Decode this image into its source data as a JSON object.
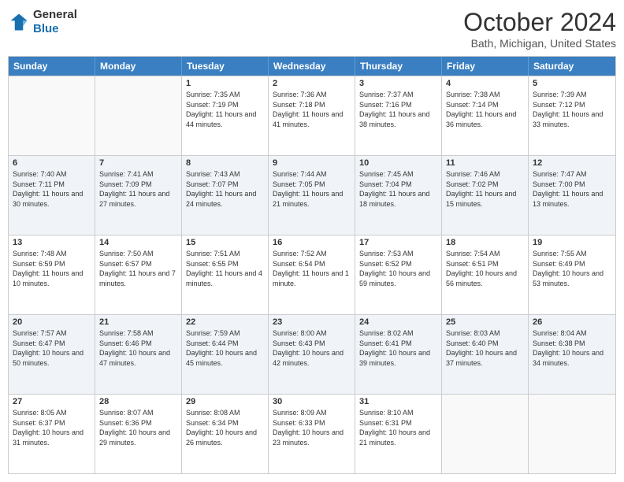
{
  "header": {
    "logo_general": "General",
    "logo_blue": "Blue",
    "title": "October 2024",
    "subtitle": "Bath, Michigan, United States"
  },
  "days": [
    "Sunday",
    "Monday",
    "Tuesday",
    "Wednesday",
    "Thursday",
    "Friday",
    "Saturday"
  ],
  "rows": [
    [
      {
        "num": "",
        "sunrise": "",
        "sunset": "",
        "daylight": "",
        "empty": true
      },
      {
        "num": "",
        "sunrise": "",
        "sunset": "",
        "daylight": "",
        "empty": true
      },
      {
        "num": "1",
        "sunrise": "Sunrise: 7:35 AM",
        "sunset": "Sunset: 7:19 PM",
        "daylight": "Daylight: 11 hours and 44 minutes."
      },
      {
        "num": "2",
        "sunrise": "Sunrise: 7:36 AM",
        "sunset": "Sunset: 7:18 PM",
        "daylight": "Daylight: 11 hours and 41 minutes."
      },
      {
        "num": "3",
        "sunrise": "Sunrise: 7:37 AM",
        "sunset": "Sunset: 7:16 PM",
        "daylight": "Daylight: 11 hours and 38 minutes."
      },
      {
        "num": "4",
        "sunrise": "Sunrise: 7:38 AM",
        "sunset": "Sunset: 7:14 PM",
        "daylight": "Daylight: 11 hours and 36 minutes."
      },
      {
        "num": "5",
        "sunrise": "Sunrise: 7:39 AM",
        "sunset": "Sunset: 7:12 PM",
        "daylight": "Daylight: 11 hours and 33 minutes."
      }
    ],
    [
      {
        "num": "6",
        "sunrise": "Sunrise: 7:40 AM",
        "sunset": "Sunset: 7:11 PM",
        "daylight": "Daylight: 11 hours and 30 minutes."
      },
      {
        "num": "7",
        "sunrise": "Sunrise: 7:41 AM",
        "sunset": "Sunset: 7:09 PM",
        "daylight": "Daylight: 11 hours and 27 minutes."
      },
      {
        "num": "8",
        "sunrise": "Sunrise: 7:43 AM",
        "sunset": "Sunset: 7:07 PM",
        "daylight": "Daylight: 11 hours and 24 minutes."
      },
      {
        "num": "9",
        "sunrise": "Sunrise: 7:44 AM",
        "sunset": "Sunset: 7:05 PM",
        "daylight": "Daylight: 11 hours and 21 minutes."
      },
      {
        "num": "10",
        "sunrise": "Sunrise: 7:45 AM",
        "sunset": "Sunset: 7:04 PM",
        "daylight": "Daylight: 11 hours and 18 minutes."
      },
      {
        "num": "11",
        "sunrise": "Sunrise: 7:46 AM",
        "sunset": "Sunset: 7:02 PM",
        "daylight": "Daylight: 11 hours and 15 minutes."
      },
      {
        "num": "12",
        "sunrise": "Sunrise: 7:47 AM",
        "sunset": "Sunset: 7:00 PM",
        "daylight": "Daylight: 11 hours and 13 minutes."
      }
    ],
    [
      {
        "num": "13",
        "sunrise": "Sunrise: 7:48 AM",
        "sunset": "Sunset: 6:59 PM",
        "daylight": "Daylight: 11 hours and 10 minutes."
      },
      {
        "num": "14",
        "sunrise": "Sunrise: 7:50 AM",
        "sunset": "Sunset: 6:57 PM",
        "daylight": "Daylight: 11 hours and 7 minutes."
      },
      {
        "num": "15",
        "sunrise": "Sunrise: 7:51 AM",
        "sunset": "Sunset: 6:55 PM",
        "daylight": "Daylight: 11 hours and 4 minutes."
      },
      {
        "num": "16",
        "sunrise": "Sunrise: 7:52 AM",
        "sunset": "Sunset: 6:54 PM",
        "daylight": "Daylight: 11 hours and 1 minute."
      },
      {
        "num": "17",
        "sunrise": "Sunrise: 7:53 AM",
        "sunset": "Sunset: 6:52 PM",
        "daylight": "Daylight: 10 hours and 59 minutes."
      },
      {
        "num": "18",
        "sunrise": "Sunrise: 7:54 AM",
        "sunset": "Sunset: 6:51 PM",
        "daylight": "Daylight: 10 hours and 56 minutes."
      },
      {
        "num": "19",
        "sunrise": "Sunrise: 7:55 AM",
        "sunset": "Sunset: 6:49 PM",
        "daylight": "Daylight: 10 hours and 53 minutes."
      }
    ],
    [
      {
        "num": "20",
        "sunrise": "Sunrise: 7:57 AM",
        "sunset": "Sunset: 6:47 PM",
        "daylight": "Daylight: 10 hours and 50 minutes."
      },
      {
        "num": "21",
        "sunrise": "Sunrise: 7:58 AM",
        "sunset": "Sunset: 6:46 PM",
        "daylight": "Daylight: 10 hours and 47 minutes."
      },
      {
        "num": "22",
        "sunrise": "Sunrise: 7:59 AM",
        "sunset": "Sunset: 6:44 PM",
        "daylight": "Daylight: 10 hours and 45 minutes."
      },
      {
        "num": "23",
        "sunrise": "Sunrise: 8:00 AM",
        "sunset": "Sunset: 6:43 PM",
        "daylight": "Daylight: 10 hours and 42 minutes."
      },
      {
        "num": "24",
        "sunrise": "Sunrise: 8:02 AM",
        "sunset": "Sunset: 6:41 PM",
        "daylight": "Daylight: 10 hours and 39 minutes."
      },
      {
        "num": "25",
        "sunrise": "Sunrise: 8:03 AM",
        "sunset": "Sunset: 6:40 PM",
        "daylight": "Daylight: 10 hours and 37 minutes."
      },
      {
        "num": "26",
        "sunrise": "Sunrise: 8:04 AM",
        "sunset": "Sunset: 6:38 PM",
        "daylight": "Daylight: 10 hours and 34 minutes."
      }
    ],
    [
      {
        "num": "27",
        "sunrise": "Sunrise: 8:05 AM",
        "sunset": "Sunset: 6:37 PM",
        "daylight": "Daylight: 10 hours and 31 minutes."
      },
      {
        "num": "28",
        "sunrise": "Sunrise: 8:07 AM",
        "sunset": "Sunset: 6:36 PM",
        "daylight": "Daylight: 10 hours and 29 minutes."
      },
      {
        "num": "29",
        "sunrise": "Sunrise: 8:08 AM",
        "sunset": "Sunset: 6:34 PM",
        "daylight": "Daylight: 10 hours and 26 minutes."
      },
      {
        "num": "30",
        "sunrise": "Sunrise: 8:09 AM",
        "sunset": "Sunset: 6:33 PM",
        "daylight": "Daylight: 10 hours and 23 minutes."
      },
      {
        "num": "31",
        "sunrise": "Sunrise: 8:10 AM",
        "sunset": "Sunset: 6:31 PM",
        "daylight": "Daylight: 10 hours and 21 minutes."
      },
      {
        "num": "",
        "sunrise": "",
        "sunset": "",
        "daylight": "",
        "empty": true
      },
      {
        "num": "",
        "sunrise": "",
        "sunset": "",
        "daylight": "",
        "empty": true
      }
    ]
  ]
}
